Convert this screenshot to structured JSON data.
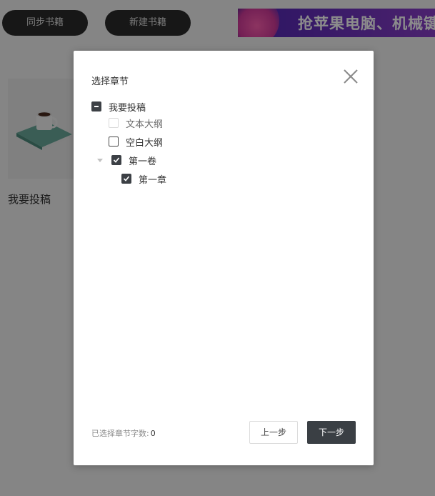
{
  "header": {
    "sync_label": "同步书籍",
    "new_label": "新建书籍",
    "banner_text": "抢苹果电脑、机械键"
  },
  "library": {
    "book_title": "我要投稿"
  },
  "dialog": {
    "title": "选择章节",
    "tree": {
      "root": {
        "label": "我要投稿",
        "state": "indeterminate"
      },
      "outline_text": {
        "label": "文本大纲",
        "state": "disabled"
      },
      "outline_empty": {
        "label": "空白大纲",
        "state": "unchecked"
      },
      "volume": {
        "label": "第一卷",
        "state": "checked",
        "expanded": true
      },
      "chapter": {
        "label": "第一章",
        "state": "checked"
      }
    },
    "count_label": "已选择章节字数:",
    "count_value": "0",
    "prev_label": "上一步",
    "next_label": "下一步"
  },
  "colors": {
    "dark_button": "#2b2b2b",
    "primary": "#3a3f44",
    "overlay": "rgba(0,0,0,0.45)"
  }
}
